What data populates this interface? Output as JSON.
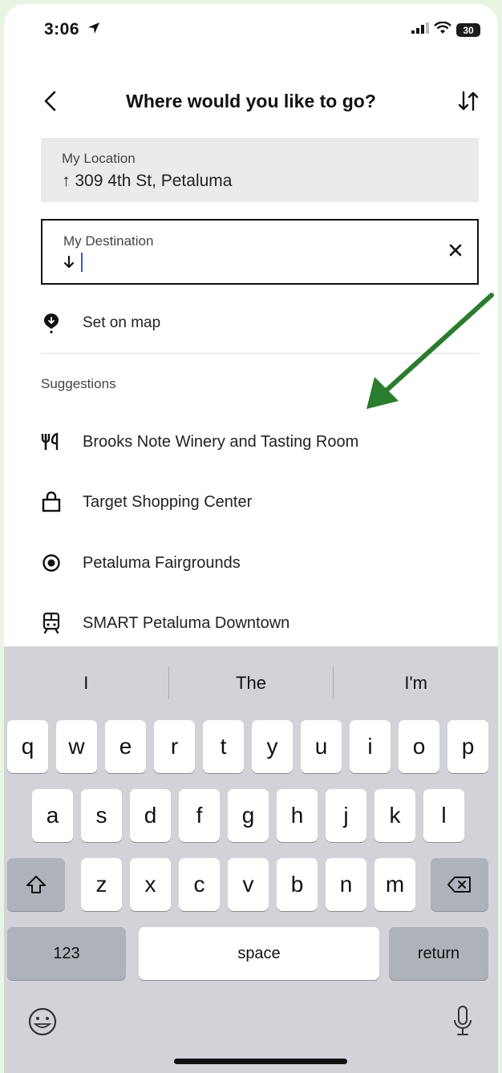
{
  "status_bar": {
    "time": "3:06",
    "battery": "30"
  },
  "nav": {
    "title": "Where would you like to go?"
  },
  "origin": {
    "label": "My Location",
    "value": "↑ 309 4th St, Petaluma"
  },
  "destination": {
    "label": "My Destination",
    "value": ""
  },
  "set_on_map": "Set on map",
  "suggestions_heading": "Suggestions",
  "suggestions": [
    {
      "label": "Brooks Note Winery and Tasting Room",
      "icon": "fork-knife-icon"
    },
    {
      "label": "Target Shopping Center",
      "icon": "shopping-bag-icon"
    },
    {
      "label": "Petaluma Fairgrounds",
      "icon": "target-dot-icon"
    },
    {
      "label": "SMART Petaluma Downtown",
      "icon": "train-icon"
    }
  ],
  "keyboard": {
    "predictions": [
      "I",
      "The",
      "I'm"
    ],
    "row1": [
      "q",
      "w",
      "e",
      "r",
      "t",
      "y",
      "u",
      "i",
      "o",
      "p"
    ],
    "row2": [
      "a",
      "s",
      "d",
      "f",
      "g",
      "h",
      "j",
      "k",
      "l"
    ],
    "row3": [
      "z",
      "x",
      "c",
      "v",
      "b",
      "n",
      "m"
    ],
    "numbers_label": "123",
    "space_label": "space",
    "return_label": "return"
  },
  "colors": {
    "accent_annotation": "#2a7d2e",
    "caret": "#2f5bd8"
  }
}
